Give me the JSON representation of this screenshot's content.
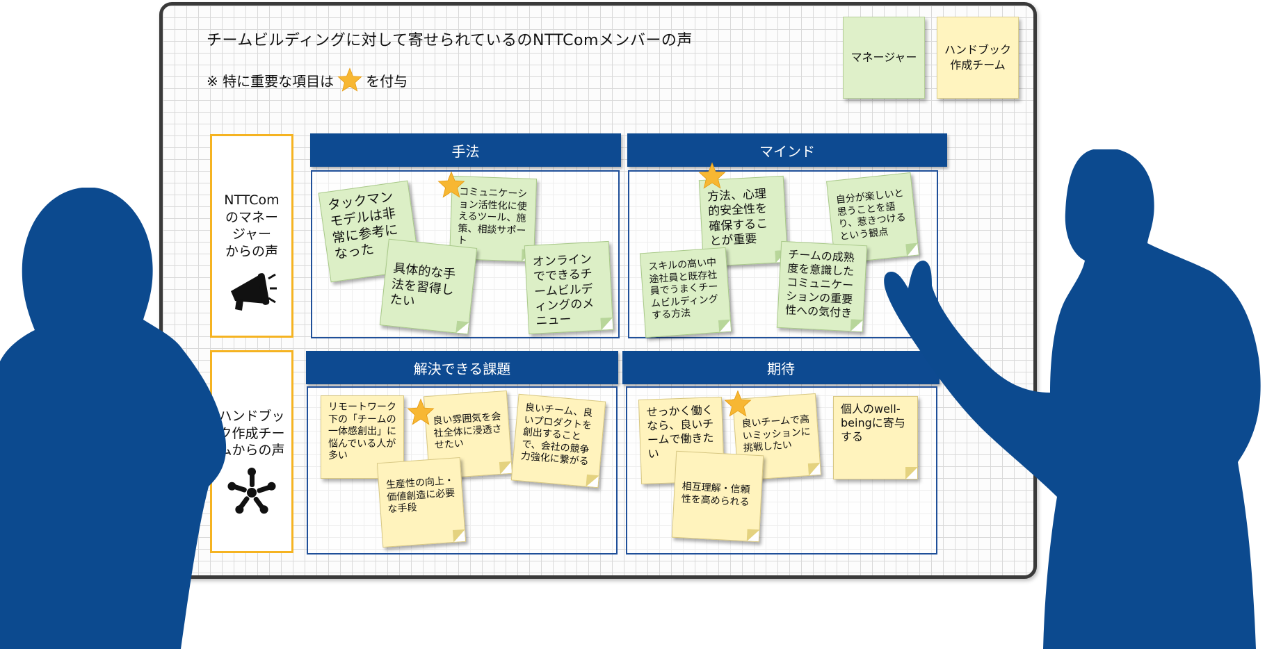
{
  "board": {
    "title": "チームビルディングに対して寄せられているのNTTComメンバーの声",
    "note_prefix": "※ 特に重要な項目は",
    "note_suffix": "を付与"
  },
  "legend": {
    "manager": "マネージャー",
    "handbook_line1": "ハンドブック",
    "handbook_line2": "作成チーム"
  },
  "rows": {
    "row1": [
      "NTTCom",
      "のマネー",
      "ジャー",
      "からの声"
    ],
    "row2": [
      "ハンドブッ",
      "ク作成チー",
      "ムからの声"
    ]
  },
  "headers": {
    "method": "手法",
    "mind": "マインド",
    "issues": "解決できる課題",
    "expectation": "期待"
  },
  "stickies": {
    "tuckman": "タックマンモデルは非常に参考になった",
    "comm_tools": "コミュニケーション活性化に使えるツール、施策、相談サポート",
    "concrete": "具体的な手法を習得したい",
    "online": "オンラインでできるチームビルディングのメニュー",
    "safety": "方法、心理的安全性を確保することが重要",
    "enjoy": "自分が楽しいと思うことを語り、惹きつけるという観点",
    "skilled": "スキルの高い中途社員と既存社員でうまくチームビルディングする方法",
    "maturity": "チームの成熟度を意識したコミュニケーションの重要性への気付き",
    "remote": "リモートワーク下の「チームの一体感創出」に悩んでいる人が多い",
    "atmosphere": "良い雰囲気を会社全体に浸透させたい",
    "good_team": "良いチーム、良いプロダクトを創出することで、会社の競争力強化に繋がる",
    "productivity": "生産性の向上・価値創造に必要な手段",
    "work_good": "せっかく働くなら、良いチームで働きたい",
    "mission": "良いチームで高いミッションに挑戦したい",
    "wellbeing": "個人のwell-beingに寄与する",
    "trust": "相互理解・信頼性を高められる"
  },
  "colors": {
    "header_blue": "#0d4a91",
    "label_orange": "#f5b321",
    "sticky_green": "#dcefc6",
    "sticky_yellow": "#fff3bd",
    "silhouette_blue": "#0c4a8f",
    "star_gold": "#f7b733"
  },
  "icons": [
    "megaphone-icon",
    "hands-circle-icon",
    "star-icon"
  ]
}
